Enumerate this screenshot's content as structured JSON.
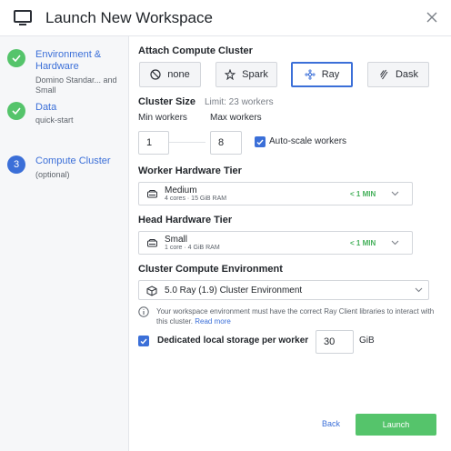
{
  "header": {
    "title": "Launch New Workspace"
  },
  "sidebar": {
    "steps": [
      {
        "number": "",
        "label": "Environment & Hardware",
        "sub": "Domino Standar... and Small"
      },
      {
        "number": "",
        "label": "Data",
        "sub": "quick-start"
      },
      {
        "number": "3",
        "label": "Compute Cluster",
        "sub": "(optional)"
      }
    ]
  },
  "cluster": {
    "title": "Attach Compute Cluster",
    "options": [
      {
        "label": "none",
        "icon": "none-icon"
      },
      {
        "label": "Spark",
        "icon": "spark-icon"
      },
      {
        "label": "Ray",
        "icon": "ray-icon"
      },
      {
        "label": "Dask",
        "icon": "dask-icon"
      }
    ],
    "selected": "Ray"
  },
  "size": {
    "title": "Cluster Size",
    "limit": "Limit: 23 workers",
    "min_label": "Min workers",
    "max_label": "Max workers",
    "min_value": "1",
    "max_value": "8",
    "autoscale_label": "Auto-scale workers",
    "autoscale_checked": true
  },
  "worker_tier": {
    "title": "Worker Hardware Tier",
    "name": "Medium",
    "spec": "4 cores · 15 GiB RAM",
    "time": "< 1 MIN"
  },
  "head_tier": {
    "title": "Head Hardware Tier",
    "name": "Small",
    "spec": "1 core · 4 GiB RAM",
    "time": "< 1 MIN"
  },
  "env": {
    "title": "Cluster Compute Environment",
    "value": "5.0 Ray (1.9) Cluster Environment",
    "info": "Your workspace environment must have the correct Ray Client libraries to interact with this cluster.",
    "link": "Read more"
  },
  "storage": {
    "label": "Dedicated local storage per worker",
    "value": "30",
    "unit": "GiB",
    "checked": true
  },
  "footer": {
    "back": "Back",
    "launch": "Launch"
  },
  "colors": {
    "accent": "#3b6fd8",
    "success": "#55c46b"
  }
}
